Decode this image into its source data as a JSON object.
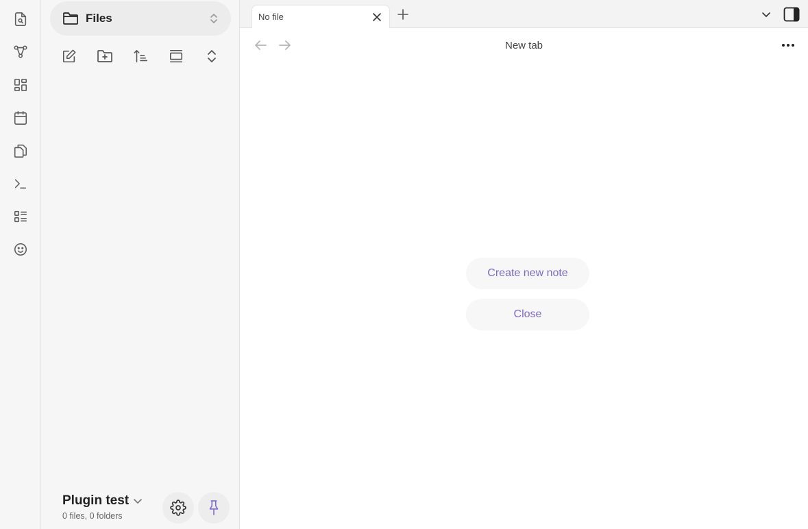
{
  "ribbon": {
    "items": [
      {
        "name": "quick-switcher-icon"
      },
      {
        "name": "graph-view-icon"
      },
      {
        "name": "canvas-icon"
      },
      {
        "name": "daily-notes-icon"
      },
      {
        "name": "templates-icon"
      },
      {
        "name": "command-palette-icon"
      },
      {
        "name": "outline-icon"
      },
      {
        "name": "emoji-icon"
      }
    ]
  },
  "sidebar": {
    "view_title": "Files",
    "nav_buttons": [
      {
        "name": "new-note-button"
      },
      {
        "name": "new-folder-button"
      },
      {
        "name": "sort-button"
      },
      {
        "name": "collapse-all-button"
      },
      {
        "name": "expand-button"
      }
    ],
    "vault": {
      "name": "Plugin test",
      "stats": "0 files, 0 folders"
    }
  },
  "tabs": [
    {
      "title": "No file",
      "active": true
    }
  ],
  "view": {
    "title": "New tab",
    "actions": [
      {
        "label": "Create new note"
      },
      {
        "label": "Close"
      }
    ]
  },
  "colors": {
    "accent": "#7d69c9",
    "sidebar_bg": "#f6f6f6",
    "tabbar_bg": "#f3f3f3"
  }
}
